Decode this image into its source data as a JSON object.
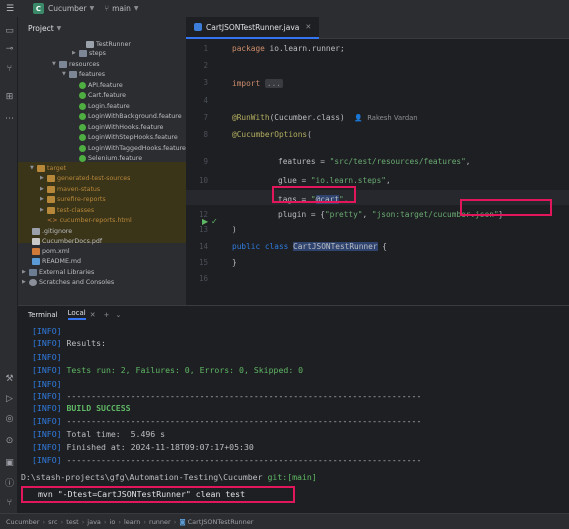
{
  "titlebar": {
    "menu_icon": "hamburger-icon",
    "project_badge": "C",
    "project_name": "Cucumber",
    "branch": "main"
  },
  "project_panel": {
    "title": "Project",
    "items": [
      {
        "label": "TestRunner",
        "icon": "java-class-icon"
      },
      {
        "label": "steps",
        "icon": "folder-icon"
      },
      {
        "label": "resources",
        "icon": "folder-icon"
      },
      {
        "label": "features",
        "icon": "folder-icon"
      },
      {
        "label": "API.feature",
        "icon": "feature-file-icon"
      },
      {
        "label": "Cart.feature",
        "icon": "feature-file-icon"
      },
      {
        "label": "Login.feature",
        "icon": "feature-file-icon"
      },
      {
        "label": "LoginWithBackground.feature",
        "icon": "feature-file-icon"
      },
      {
        "label": "LoginWithHooks.feature",
        "icon": "feature-file-icon"
      },
      {
        "label": "LoginWithStepHooks.feature",
        "icon": "feature-file-icon"
      },
      {
        "label": "LoginWithTaggedHooks.feature",
        "icon": "feature-file-icon"
      },
      {
        "label": "Selenium.feature",
        "icon": "feature-file-icon"
      },
      {
        "label": "target",
        "icon": "folder-icon"
      },
      {
        "label": "generated-test-sources",
        "icon": "folder-icon"
      },
      {
        "label": "maven-status",
        "icon": "folder-icon"
      },
      {
        "label": "surefire-reports",
        "icon": "folder-icon"
      },
      {
        "label": "test-classes",
        "icon": "folder-icon"
      },
      {
        "label": "cucumber-reports.html",
        "icon": "html-file-icon"
      },
      {
        "label": ".gitignore",
        "icon": "file-icon"
      },
      {
        "label": "CucumberDocs.pdf",
        "icon": "pdf-file-icon"
      },
      {
        "label": "pom.xml",
        "icon": "xml-file-icon"
      },
      {
        "label": "README.md",
        "icon": "markdown-file-icon"
      },
      {
        "label": "External Libraries",
        "icon": "library-icon"
      },
      {
        "label": "Scratches and Consoles",
        "icon": "scratches-icon"
      }
    ]
  },
  "editor": {
    "tab_label": "CartJSONTestRunner.java",
    "line_numbers": [
      "1",
      "2",
      "3",
      "4",
      "7",
      "8",
      "9",
      "10",
      "11",
      "12",
      "13",
      "14",
      "15",
      "16"
    ],
    "lines": {
      "l1_kw": "package",
      "l1_rest": " io.learn.runner;",
      "l3_kw": "import",
      "l3_fold": "...",
      "l7_ann": "@RunWith",
      "l7_rest": "(Cucumber.class)",
      "l7_author": "Rakesh Vardan",
      "l8_ann": "@CucumberOptions",
      "l8_rest": "(",
      "l9_key": "features = ",
      "l9_str": "\"src/test/resources/features\"",
      "l9_end": ",",
      "l10_key": "glue = ",
      "l10_str": "\"io.learn.steps\"",
      "l10_end": ",",
      "l11_key": "tags = ",
      "l11_q1": "\"",
      "l11_tag": "@cart",
      "l11_q2": "\"",
      "l11_end": ",",
      "l12_key": "plugin = {",
      "l12_str1": "\"pretty\"",
      "l12_mid": ", ",
      "l12_str2a": "\"json:target/",
      "l12_str2b": "cucumber.json\"",
      "l12_end": "}",
      "l13": ")",
      "l14_kw1": "public",
      "l14_kw2": " class ",
      "l14_name": "CartJSONTestRunner",
      "l14_end": " {",
      "l15": "}"
    }
  },
  "terminal": {
    "tab_terminal": "Terminal",
    "tab_local": "Local",
    "lines": [
      {
        "tag": "[INFO]",
        "text": ""
      },
      {
        "tag": "[INFO]",
        "text": " Results:"
      },
      {
        "tag": "[INFO]",
        "text": ""
      },
      {
        "tag": "[INFO]",
        "text": " Tests run: 2, Failures: 0, Errors: 0, Skipped: 0"
      },
      {
        "tag": "[INFO]",
        "text": ""
      },
      {
        "tag": "[INFO]",
        "text": " ------------------------------------------------------------------------"
      },
      {
        "tag": "[INFO]",
        "text": " BUILD SUCCESS"
      },
      {
        "tag": "[INFO]",
        "text": " ------------------------------------------------------------------------"
      },
      {
        "tag": "[INFO]",
        "text": " Total time:  5.496 s"
      },
      {
        "tag": "[INFO]",
        "text": " Finished at: 2024-11-18T09:07:17+05:30"
      },
      {
        "tag": "[INFO]",
        "text": " ------------------------------------------------------------------------"
      }
    ],
    "prompt_path": "D:\\stash-projects\\gfg\\Automation-Testing\\Cucumber",
    "prompt_git": " git:",
    "prompt_branch": "[main]",
    "command": "mvn \"-Dtest=CartJSONTestRunner\" clean test"
  },
  "statusbar": {
    "crumbs": [
      "Cucumber",
      "src",
      "test",
      "java",
      "io",
      "learn",
      "runner",
      "CartJSONTestRunner"
    ]
  }
}
